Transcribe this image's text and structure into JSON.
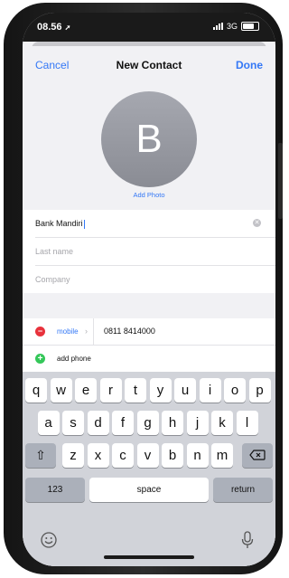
{
  "status": {
    "time": "08.56",
    "network": "3G"
  },
  "nav": {
    "cancel": "Cancel",
    "title": "New Contact",
    "done": "Done"
  },
  "avatar": {
    "initial": "B",
    "add_photo": "Add Photo"
  },
  "fields": {
    "first_name_value": "Bank Mandiri",
    "last_name_placeholder": "Last name",
    "company_placeholder": "Company"
  },
  "phone": {
    "label": "mobile",
    "number": "0811 8414000",
    "add_label": "add phone"
  },
  "keyboard": {
    "row1": [
      "q",
      "w",
      "e",
      "r",
      "t",
      "y",
      "u",
      "i",
      "o",
      "p"
    ],
    "row2": [
      "a",
      "s",
      "d",
      "f",
      "g",
      "h",
      "j",
      "k",
      "l"
    ],
    "row3": [
      "z",
      "x",
      "c",
      "v",
      "b",
      "n",
      "m"
    ],
    "numbers_key": "123",
    "space_key": "space",
    "return_key": "return"
  },
  "colors": {
    "accent": "#3478f6",
    "delete": "#e8323c",
    "add": "#34c759"
  },
  "icons": [
    "location-arrow-icon",
    "signal-icon",
    "battery-icon",
    "clear-text-icon",
    "minus-circle-icon",
    "chevron-right-icon",
    "plus-circle-icon",
    "shift-icon",
    "backspace-icon",
    "emoji-icon",
    "microphone-icon"
  ]
}
